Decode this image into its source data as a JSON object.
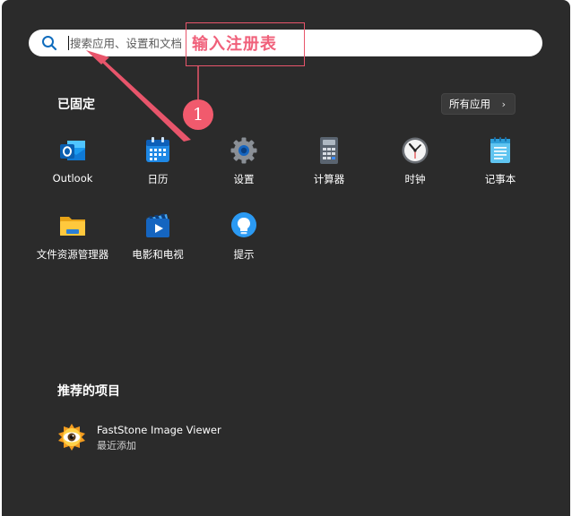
{
  "search": {
    "placeholder": "搜索应用、设置和文档"
  },
  "annotation": {
    "label": "输入注册表",
    "step_number": "1"
  },
  "pinned": {
    "title": "已固定",
    "all_apps_label": "所有应用",
    "apps": [
      {
        "label": "Outlook",
        "icon": "outlook-icon"
      },
      {
        "label": "日历",
        "icon": "calendar-icon"
      },
      {
        "label": "设置",
        "icon": "settings-gear-icon"
      },
      {
        "label": "计算器",
        "icon": "calculator-icon"
      },
      {
        "label": "时钟",
        "icon": "clock-icon"
      },
      {
        "label": "记事本",
        "icon": "notepad-icon"
      },
      {
        "label": "文件资源管理器",
        "icon": "file-explorer-icon"
      },
      {
        "label": "电影和电视",
        "icon": "movies-tv-icon"
      },
      {
        "label": "提示",
        "icon": "tips-icon"
      }
    ]
  },
  "recommended": {
    "title": "推荐的项目",
    "items": [
      {
        "name": "FastStone Image Viewer",
        "subtitle": "最近添加",
        "icon": "faststone-eye-icon"
      }
    ]
  },
  "colors": {
    "menu_bg": "#2b2b2b",
    "annotation": "#f0607a",
    "search_bg": "#ffffff"
  }
}
